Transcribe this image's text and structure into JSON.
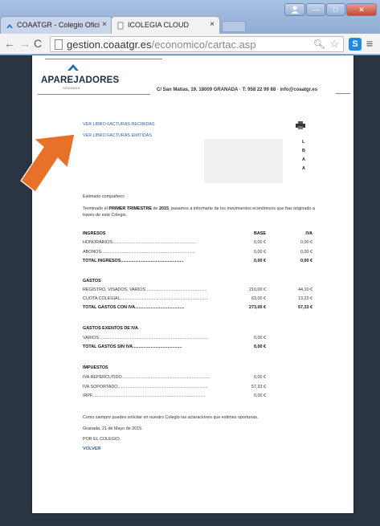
{
  "browser": {
    "tabs": [
      {
        "label": "COAATGR - Colegio Ofici",
        "active": false
      },
      {
        "label": "ICOLEGIA CLOUD",
        "active": true
      }
    ],
    "url": {
      "host": "gestion.coaatgr.es",
      "path": "/economico/cartac.asp"
    },
    "window_buttons": {
      "user": "user",
      "minimize": "—",
      "maximize": "□",
      "close": "✕"
    }
  },
  "letterhead": {
    "brand": "APAREJADORES",
    "brand_sub": "GRANADA",
    "address": "C/ San Matías, 19. 18009 GRANADA · T: 958 22 99 88 · info@coaatgr.es"
  },
  "links": {
    "recibidas": "VER LIBRO FACTURAS RECIBIDAS",
    "emitidas": "VER LIBRO FACTURAS EMITIDAS"
  },
  "redacted_letters": [
    "L",
    "B",
    "A",
    "A"
  ],
  "letter": {
    "greeting": "Estimado compañero:",
    "intro_before": "Terminado el ",
    "intro_period": "PRIMER TRIMESTRE",
    "intro_mid": " de ",
    "intro_year": "2015",
    "intro_after": ", pasamos a informarte de los movimientos económicos que has originado a través de este Colegio."
  },
  "headers": {
    "base": "BASE",
    "iva": "IVA"
  },
  "sections": {
    "ingresos": {
      "title": "INGRESOS",
      "rows": [
        {
          "label": "HONORARIOS......................................................................",
          "base": "0,00 €",
          "iva": "0,00 €"
        },
        {
          "label": "ABONOS..............................................................................",
          "base": "0,00 €",
          "iva": "0,00 €"
        }
      ],
      "total": {
        "label": "TOTAL INGRESOS....................................................",
        "base": "0,00 €",
        "iva": "0,00 €"
      }
    },
    "gastos": {
      "title": "GASTOS",
      "rows": [
        {
          "label": "REGISTRO, VISADOS, VARIOS ..................................................",
          "base": "210,00 €",
          "iva": "44,10 €"
        },
        {
          "label": "CUOTA COLEGIAL.........................................................................",
          "base": "63,00 €",
          "iva": "13,23 €"
        }
      ],
      "total": {
        "label": "TOTAL GASTOS CON IVA.........................................",
        "base": "273,00 €",
        "iva": "57,33 €"
      }
    },
    "exentos": {
      "title": "GASTOS EXENTOS DE IVA",
      "rows": [
        {
          "label": "VARIOS...........................................................................................",
          "base": "0,00 €"
        }
      ],
      "total": {
        "label": "TOTAL GASTOS SIN IVA.........................................",
        "base": "0,00 €"
      }
    },
    "impuestos": {
      "title": "IMPUESTOS",
      "rows": [
        {
          "label": "IVA REPERCUTIDO.........................................................................",
          "base": "0,00 €"
        },
        {
          "label": "IVA SOPORTADO...........................................................................",
          "base": "57,33 €"
        },
        {
          "label": "IRPF..............................................................................................",
          "base": "0,00 €"
        }
      ]
    }
  },
  "closing": {
    "line1": "Como siempre puedes solicitar en nuestro Colegio las aclaraciones que estimes oportunas.",
    "line2": "Granada, 21 de Mayo de 2015.",
    "line3": "POR EL COLEGIO."
  },
  "volver": "VOLVER",
  "colors": {
    "link": "#2f5fa7",
    "brand": "#1c2d4a",
    "arrow": "#e8712a",
    "page_bg": "#2b3442"
  }
}
